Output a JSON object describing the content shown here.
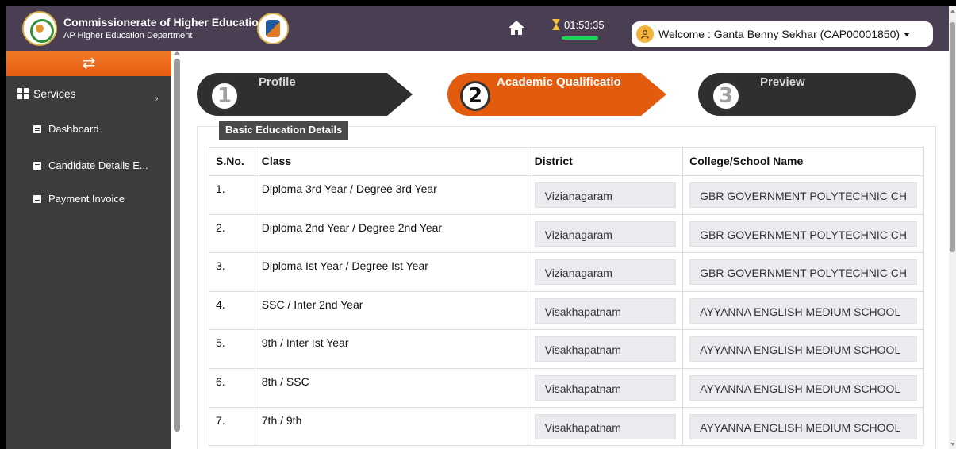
{
  "header": {
    "org_title": "Commissionerate of Higher Education",
    "org_subtitle": "AP Higher Education Department",
    "timer": "01:53:35",
    "welcome": "Welcome : Ganta Benny Sekhar (CAP00001850)",
    "bg_color": "#4a3f52",
    "timer_bar_color": "#1fd35a"
  },
  "sidebar": {
    "toggle_icon": "swap-arrows-icon",
    "services_label": "Services",
    "items": [
      {
        "label": "Dashboard",
        "icon": "document-icon"
      },
      {
        "label": "Candidate Details E...",
        "icon": "document-icon"
      },
      {
        "label": "Payment Invoice",
        "icon": "document-icon"
      }
    ],
    "accent_color": "#ee6d1c"
  },
  "steps": [
    {
      "number": "1",
      "label": "Profile",
      "state": "inactive"
    },
    {
      "number": "2",
      "label": "Academic Qualificatio",
      "state": "active"
    },
    {
      "number": "3",
      "label": "Preview",
      "state": "inactive"
    }
  ],
  "section": {
    "title": "Basic Education Details",
    "columns": [
      "S.No.",
      "Class",
      "District",
      "College/School Name"
    ],
    "rows": [
      {
        "sno": "1.",
        "class": "Diploma 3rd Year / Degree 3rd Year",
        "district": "Vizianagaram",
        "college": "GBR GOVERNMENT POLYTECHNIC CH"
      },
      {
        "sno": "2.",
        "class": "Diploma 2nd Year / Degree 2nd Year",
        "district": "Vizianagaram",
        "college": "GBR GOVERNMENT POLYTECHNIC CH"
      },
      {
        "sno": "3.",
        "class": "Diploma Ist Year / Degree Ist Year",
        "district": "Vizianagaram",
        "college": "GBR GOVERNMENT POLYTECHNIC CH"
      },
      {
        "sno": "4.",
        "class": "SSC / Inter 2nd Year",
        "district": "Visakhapatnam",
        "college": "AYYANNA ENGLISH MEDIUM SCHOOL"
      },
      {
        "sno": "5.",
        "class": "9th / Inter Ist Year",
        "district": "Visakhapatnam",
        "college": "AYYANNA ENGLISH MEDIUM SCHOOL"
      },
      {
        "sno": "6.",
        "class": "8th / SSC",
        "district": "Visakhapatnam",
        "college": "AYYANNA ENGLISH MEDIUM SCHOOL"
      },
      {
        "sno": "7.",
        "class": "7th / 9th",
        "district": "Visakhapatnam",
        "college": "AYYANNA ENGLISH MEDIUM SCHOOL"
      }
    ]
  }
}
